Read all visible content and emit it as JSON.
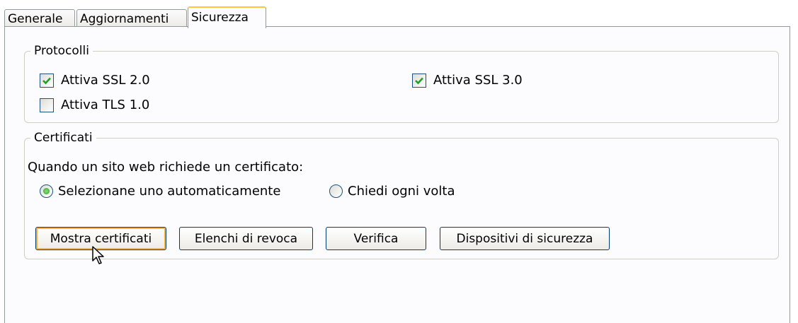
{
  "tabs": [
    {
      "label": "Generale",
      "active": false
    },
    {
      "label": "Aggiornamenti",
      "active": false
    },
    {
      "label": "Sicurezza",
      "active": true
    }
  ],
  "protocols": {
    "title": "Protocolli",
    "ssl2": {
      "label": "Attiva SSL 2.0",
      "checked": true
    },
    "ssl3": {
      "label": "Attiva SSL 3.0",
      "checked": true
    },
    "tls1": {
      "label": "Attiva TLS 1.0",
      "checked": false
    }
  },
  "certificates": {
    "title": "Certificati",
    "prompt": "Quando un sito web richiede un certificato:",
    "radio_auto": {
      "label": "Selezionane uno automaticamente",
      "selected": true
    },
    "radio_ask": {
      "label": "Chiedi ogni volta",
      "selected": false
    },
    "buttons": {
      "show": "Mostra certificati",
      "revocation": "Elenchi di revoca",
      "verify": "Verifica",
      "devices": "Dispositivi di sicurezza"
    }
  },
  "colors": {
    "check": "#21a121",
    "focus_ring": "#f8b33c",
    "active_tab_top": "#ffc83c"
  },
  "icons": {
    "check": "checkmark-icon",
    "cursor": "mouse-pointer-icon"
  }
}
